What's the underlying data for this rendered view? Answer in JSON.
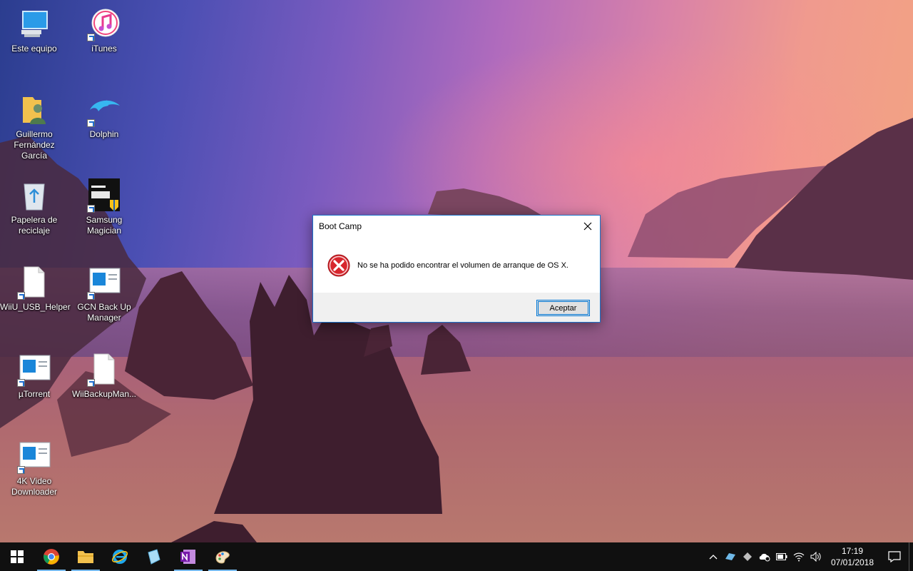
{
  "desktop": {
    "icons": [
      {
        "label": "Este equipo"
      },
      {
        "label": "iTunes"
      },
      {
        "label": "Guillermo Fernández García"
      },
      {
        "label": "Dolphin"
      },
      {
        "label": "Papelera de reciclaje"
      },
      {
        "label": "Samsung Magician"
      },
      {
        "label": "WiiU_USB_Helper"
      },
      {
        "label": "GCN Back Up Manager"
      },
      {
        "label": "µTorrent"
      },
      {
        "label": "WiiBackupMan..."
      },
      {
        "label": "4K Video Downloader"
      }
    ]
  },
  "dialog": {
    "title": "Boot Camp",
    "message": "No se ha podido encontrar el volumen de arranque de OS X.",
    "ok_label": "Aceptar"
  },
  "taskbar": {
    "apps": [
      "windows-start-icon",
      "chrome-icon",
      "file-explorer-icon",
      "internet-explorer-icon",
      "paint-3d-icon",
      "onenote-icon",
      "paint-icon"
    ],
    "clock_time": "17:19",
    "clock_date": "07/01/2018"
  },
  "colors": {
    "taskbar": "#101010",
    "accent": "#0078d7",
    "error": "#d7262d"
  }
}
